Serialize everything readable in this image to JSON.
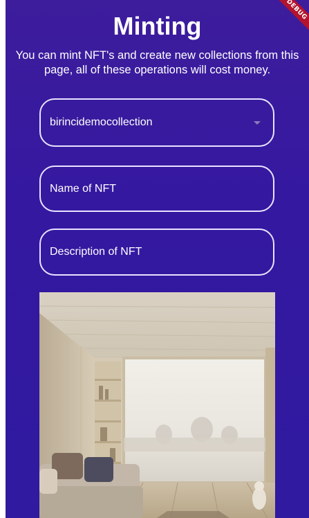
{
  "page": {
    "title": "Minting",
    "subtitle": "You can mint NFT's and create new collections from this page, all of these operations will cost money.",
    "debug_banner": "DEBUG"
  },
  "form": {
    "collection_dropdown": {
      "selected": "birincidemocollection",
      "icon": "caret-down-icon"
    },
    "name_field": {
      "placeholder": "Name of NFT",
      "value": ""
    },
    "description_field": {
      "placeholder": "Description of NFT",
      "value": ""
    }
  },
  "preview_image": {
    "subject": "living room with sofa, shelves and large window",
    "alt": "NFT preview image"
  },
  "colors": {
    "background": "#3418a0",
    "text": "#ffffff",
    "field_border": "#e9e4ff",
    "debug_banner": "#b3132c"
  }
}
